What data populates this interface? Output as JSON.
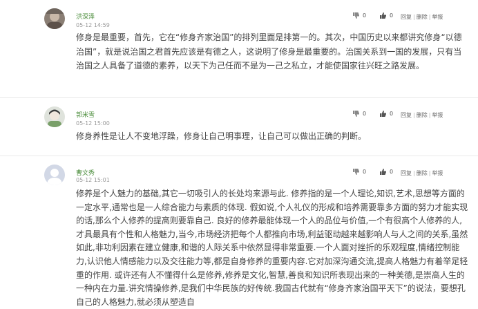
{
  "comments": [
    {
      "user": "洪深泽",
      "time": "05-12 14:59",
      "content": "修身是最重要，首先，它在“修身齐家治国”的排列里面是排第一的。其次，中国历史以来都讲究修身“以德治国”，就是说治国之君首先应该是有德之人，这说明了修身是最重要的。治国关系到一国的发展，只有当治国之人具备了道德的素养，以天下为己任而不是为一己之私立，才能使国家往兴旺之路发展。",
      "dislikes": "0",
      "likes": "0"
    },
    {
      "user": "郭米雪",
      "time": "05-12 15:00",
      "content": "修身养性是让人不变地浮躁，修身让自己明事理，让自己可以做出正确的判断。",
      "dislikes": "0",
      "likes": "0"
    },
    {
      "user": "曹文秀",
      "time": "05-12 15:01",
      "content": "修养是个人魅力的基础,其它一切吸引人的长处均来源与此. 修养指的是一个人理论,知识,艺术,思想等方面的一定水平,通常也是一人综合能力与素质的体现. 假如说,个人礼仪的形成和培养需要靠多方面的努力才能实现的话,那么个人修养的提高则要靠自己. 良好的修养最能体现一个人的品位与价值,一个有很高个人修养的人,才具最具有个性和人格魅力,当今,市场经济把每个人都推向市场,利益驱动越来越影响人与人之间的关系,虽然如此,非功利因素在建立健康,和谐的人际关系中依然显得非常重要.一个人面对挫折的乐观程度,情绪控制能力,认识他人情感能力以及交往能力等,都是自身修养的重要内容.它对加深沟通交流,提高人格魅力有着举足轻重的作用. 或许还有人不懂得什么是修养,修养是文化,智慧,善良和知识所表现出来的一种美德,是崇高人生的一种内在力量.讲究情操修养,是我们中华民族的好传统.我国古代就有“修身齐家治国平天下”的说法，要想孔自己的人格魅力,就必须从塑造自",
      "dislikes": "0",
      "likes": "0"
    }
  ],
  "actions": {
    "reply": "回复",
    "delete": "删除",
    "report": "举报",
    "separator": "|"
  }
}
